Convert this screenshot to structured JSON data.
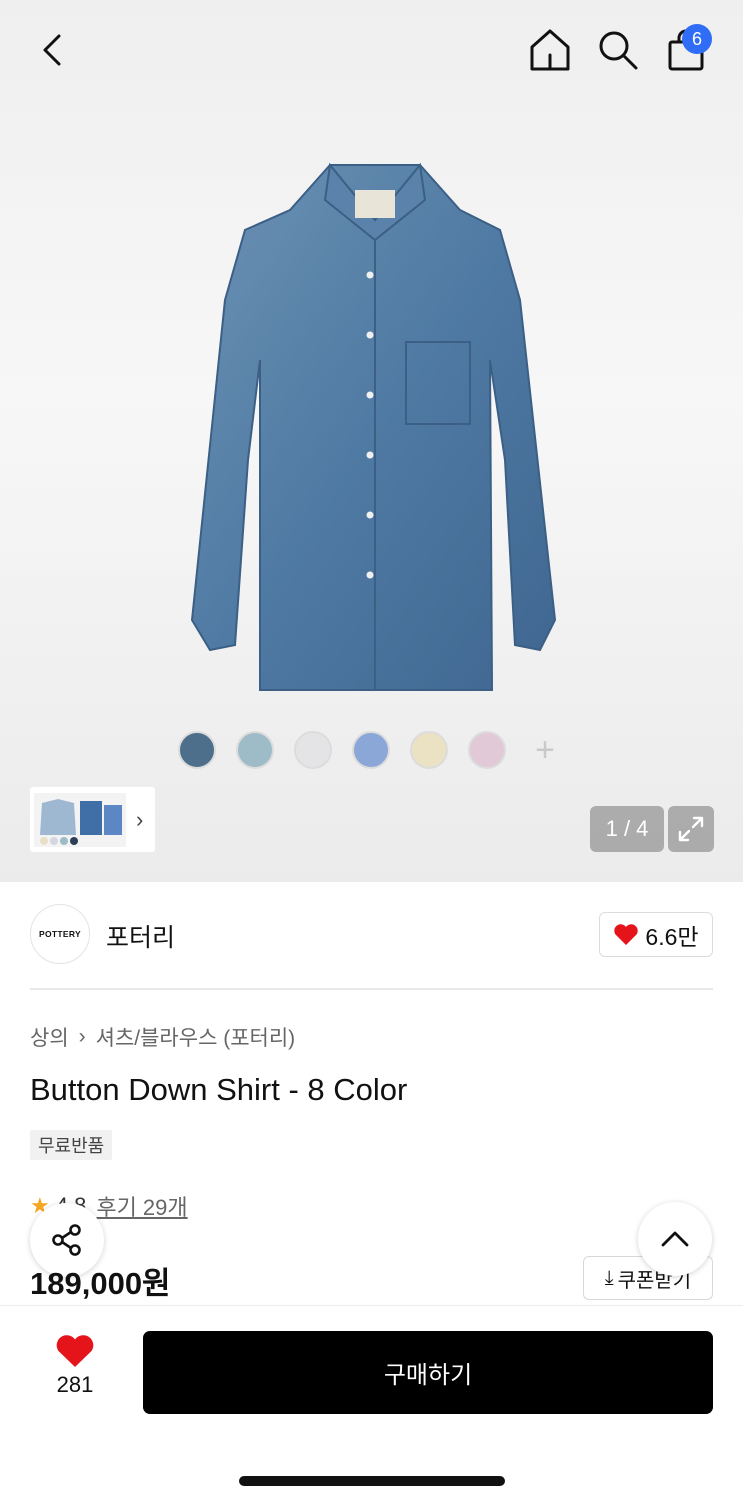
{
  "header": {
    "cart_badge": "6"
  },
  "gallery": {
    "swatches": [
      "#4d6f8c",
      "#9dbcc7",
      "#e4e4e6",
      "#8aa7d8",
      "#eae2c3",
      "#e2c9d8"
    ],
    "counter": "1 / 4"
  },
  "brand": {
    "logo_text": "POTTERY",
    "name": "포터리",
    "likes": "6.6만"
  },
  "product": {
    "breadcrumb": [
      "상의",
      "셔츠/블라우스 (포터리)"
    ],
    "title": "Button Down Shirt - 8 Color",
    "tag": "무료반품",
    "rating": "4.8",
    "reviews": "후기 29개",
    "price": "189,000원",
    "coupon_label": "쿠폰받기"
  },
  "bottom_bar": {
    "wish_count": "281",
    "buy_label": "구매하기"
  },
  "colors": {
    "accent": "#2f6df6",
    "heart": "#e5141b",
    "star": "#f5a623"
  }
}
